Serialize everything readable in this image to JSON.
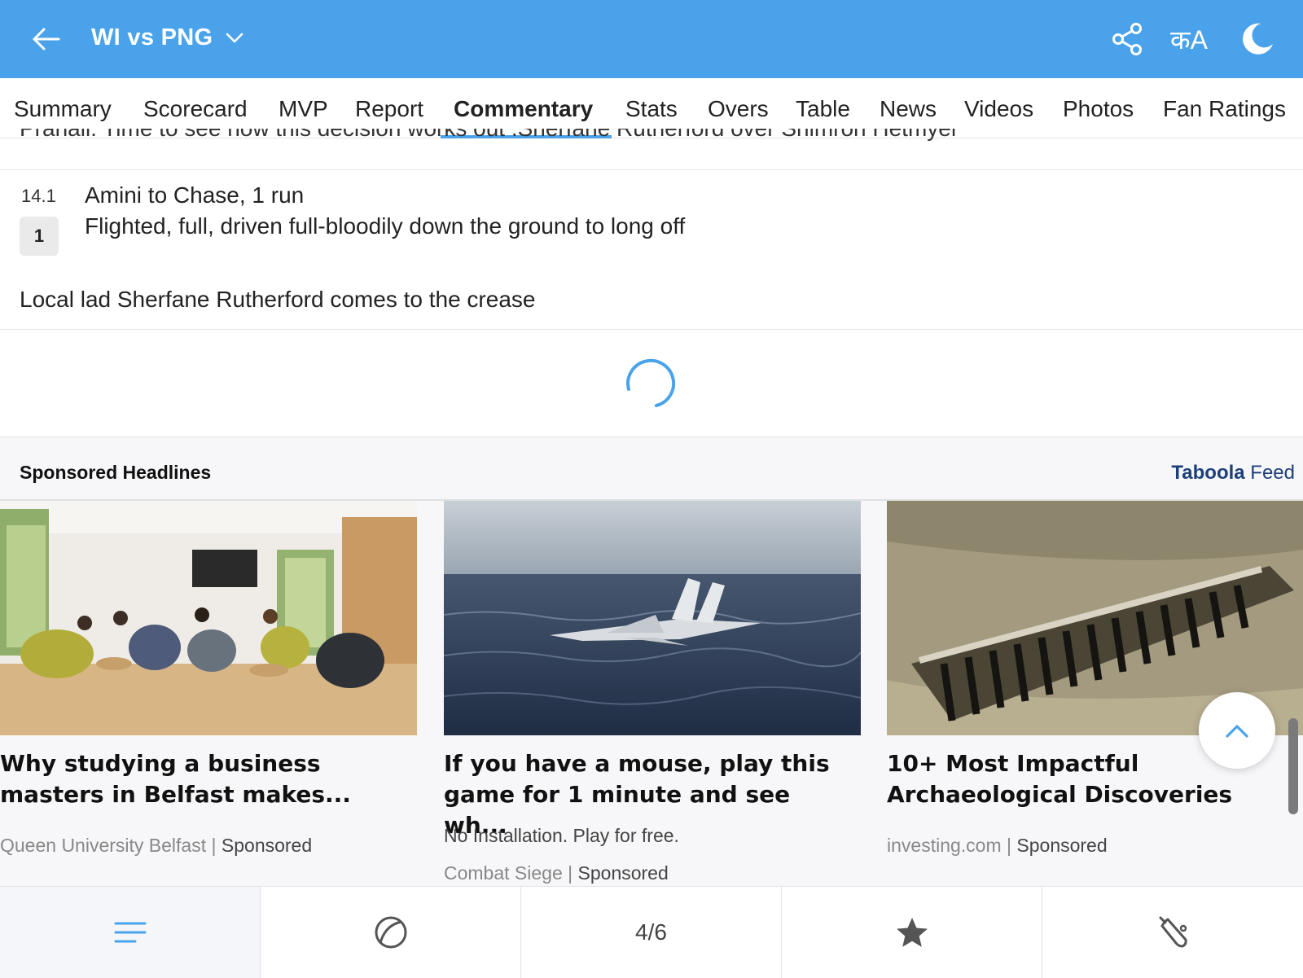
{
  "header": {
    "title": "WI vs PNG",
    "lang_label": "कA",
    "colors": {
      "bar": "#4aa3ea"
    }
  },
  "tabs": [
    "Summary",
    "Scorecard",
    "MVP",
    "Report",
    "Commentary",
    "Stats",
    "Overs",
    "Table",
    "News",
    "Videos",
    "Photos",
    "Fan Ratings"
  ],
  "active_tab": "Commentary",
  "commentary": {
    "clipped_text": "Pranali: Time to see how this decision works out .Sherfane Rutherford over Shimron Hetmyer",
    "ball": {
      "over": "14.1",
      "runs": "1",
      "title": "Amini to Chase, 1 run",
      "description": "Flighted, full, driven full-bloodily down the ground to long off"
    },
    "note": "Local lad Sherfane Rutherford comes to the crease"
  },
  "sponsored": {
    "heading": "Sponsored Headlines",
    "provider_bold": "Taboola",
    "provider_suffix": " Feed",
    "cards": [
      {
        "title": "Why studying a business masters in Belfast makes...",
        "description": "",
        "source": "Queen University Belfast",
        "sponsored": "Sponsored",
        "image": "office-lounge-image"
      },
      {
        "title": "If you have a mouse, play this game for 1 minute and see wh...",
        "description": "No Installation. Play for free.",
        "source": "Combat Siege",
        "sponsored": "Sponsored",
        "image": "jet-over-sea-image"
      },
      {
        "title": "10+ Most Impactful Archaeological Discoveries",
        "description": "",
        "source": "investing.com",
        "sponsored": "Sponsored",
        "image": "ancient-ship-image"
      }
    ]
  },
  "bottom_nav": {
    "items": [
      "menu-icon",
      "ball-icon",
      "4/6",
      "star-icon",
      "bat-icon"
    ],
    "page_indicator": "4/6"
  }
}
